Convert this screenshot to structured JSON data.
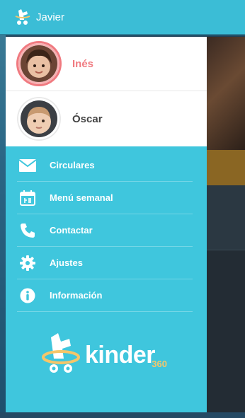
{
  "app": {
    "title": "Javier",
    "brand_word": "kinder",
    "brand_sub": "360"
  },
  "profiles": [
    {
      "name": "Inés",
      "selected": true
    },
    {
      "name": "Óscar",
      "selected": false
    }
  ],
  "menu": [
    {
      "label": "Circulares",
      "icon": "envelope-icon"
    },
    {
      "label": "Menú semanal",
      "icon": "calendar-icon"
    },
    {
      "label": "Contactar",
      "icon": "phone-icon"
    },
    {
      "label": "Ajustes",
      "icon": "gear-icon"
    },
    {
      "label": "Información",
      "icon": "info-icon"
    }
  ],
  "colors": {
    "accent": "#3fc6dd",
    "active_name": "#f07a80",
    "brand_orange": "#f5c66a"
  }
}
